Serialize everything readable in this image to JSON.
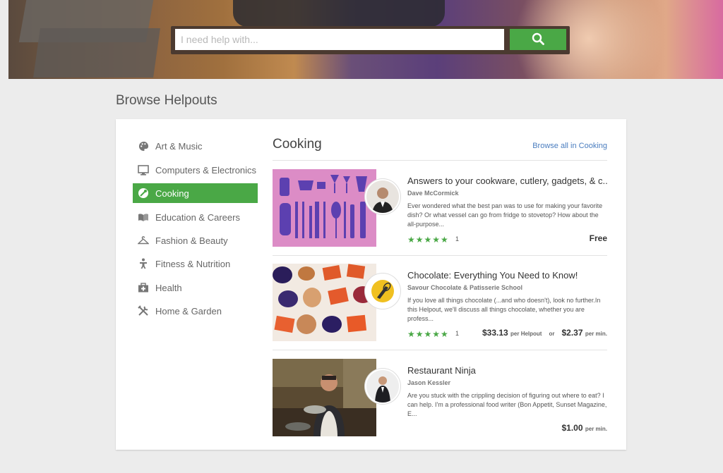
{
  "search": {
    "placeholder": "I need help with..."
  },
  "page_title": "Browse Helpouts",
  "sidebar": {
    "items": [
      {
        "label": "Art & Music",
        "icon": "palette-icon"
      },
      {
        "label": "Computers & Electronics",
        "icon": "monitor-icon"
      },
      {
        "label": "Cooking",
        "icon": "cooking-icon",
        "active": true
      },
      {
        "label": "Education & Careers",
        "icon": "book-icon"
      },
      {
        "label": "Fashion & Beauty",
        "icon": "hanger-icon"
      },
      {
        "label": "Fitness & Nutrition",
        "icon": "fitness-icon"
      },
      {
        "label": "Health",
        "icon": "first-aid-icon"
      },
      {
        "label": "Home & Garden",
        "icon": "tools-icon"
      }
    ]
  },
  "section": {
    "title": "Cooking",
    "browse_all": "Browse all in Cooking"
  },
  "listings": [
    {
      "title": "Answers to your cookware, cutlery, gadgets, & c...",
      "author": "Dave McCormick",
      "description": "Ever wondered what the best pan was to use for making your favorite dish? Or what vessel can go from fridge to stovetop? How about the all-purpose...",
      "stars": "★★★★★",
      "rating_count": "1",
      "price": "Free"
    },
    {
      "title": "Chocolate: Everything You Need to Know!",
      "author": "Savour Chocolate & Patisserie School",
      "description": "If you love all things chocolate (...and who doesn't), look no further.In this Helpout, we'll discuss all things chocolate, whether you are profess...",
      "stars": "★★★★★",
      "rating_count": "1",
      "price": "$33.13",
      "price_unit": "per Helpout",
      "or": "or",
      "price2": "$2.37",
      "price2_unit": "per min."
    },
    {
      "title": "Restaurant Ninja",
      "author": "Jason Kessler",
      "description": "Are you stuck with the crippling decision of figuring out where to eat? I can help. I'm a professional food writer (Bon Appetit, Sunset Magazine, E...",
      "price": "$1.00",
      "price_unit": "per min."
    }
  ],
  "colors": {
    "accent": "#4aa846",
    "link": "#4a7dbf",
    "search_frame": "#4b3a30"
  }
}
